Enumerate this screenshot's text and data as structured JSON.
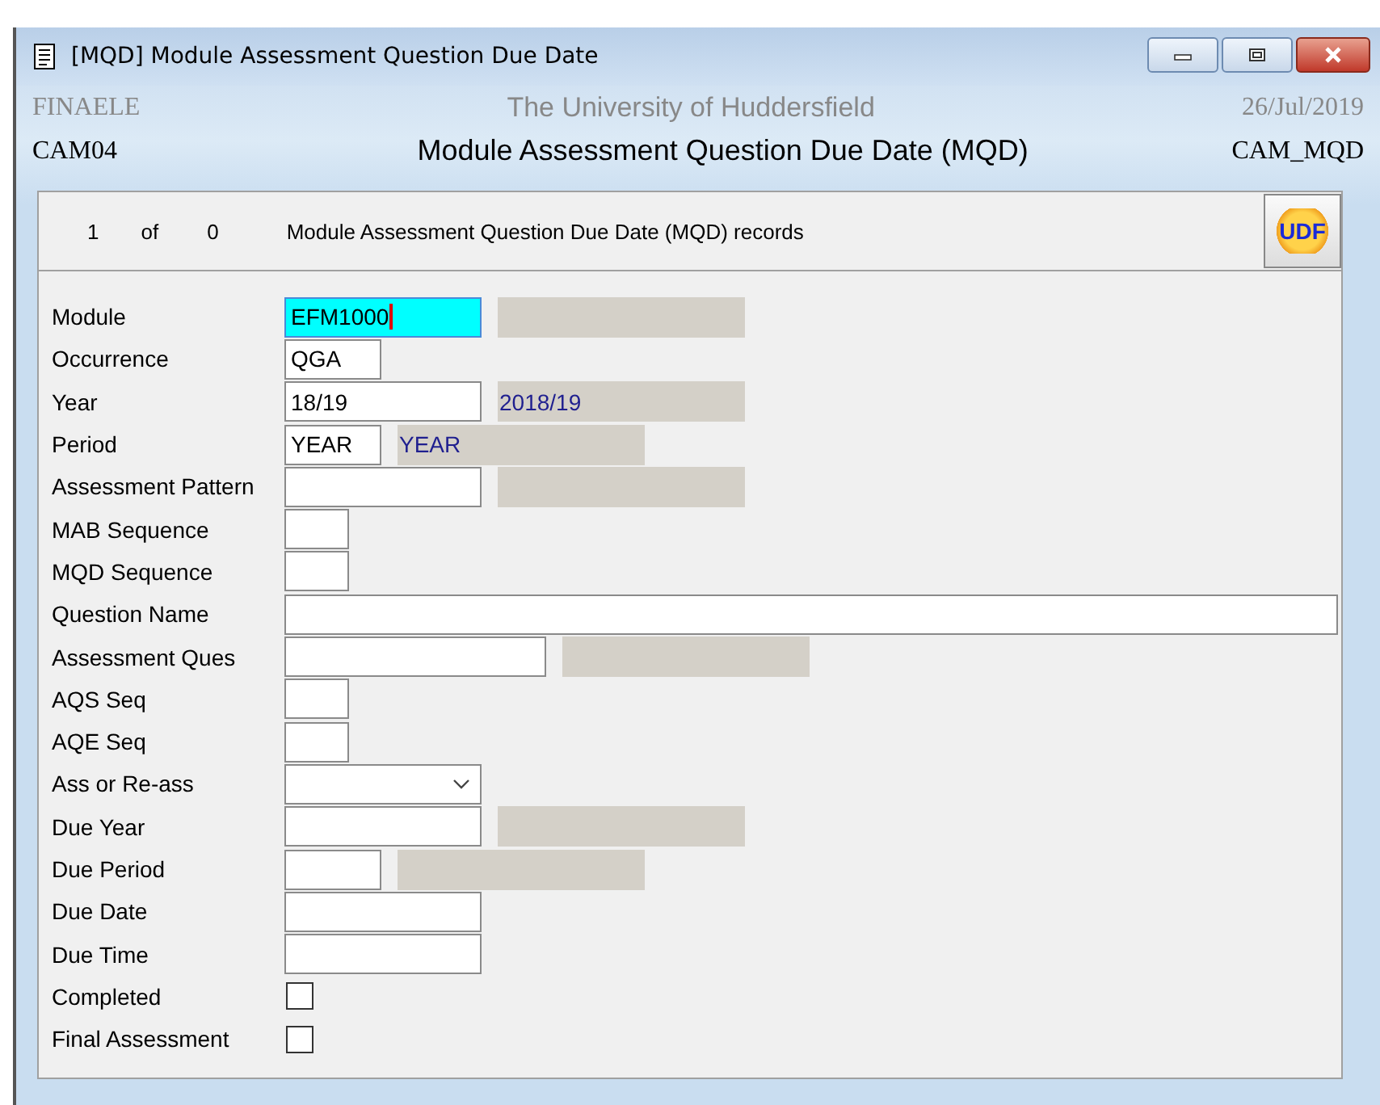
{
  "window": {
    "title": "[MQD] Module Assessment Question Due Date"
  },
  "header": {
    "system": "FINAELE",
    "institution": "The University of Huddersfield",
    "date": "26/Jul/2019",
    "screen_code": "CAM04",
    "screen_title": "Module Assessment Question Due Date (MQD)",
    "screen_id": "CAM_MQD"
  },
  "record_bar": {
    "current": "1",
    "of": "of",
    "total": "0",
    "description": "Module Assessment Question Due Date (MQD) records",
    "udf_button": "UDF"
  },
  "fields": [
    {
      "label": "Module",
      "kind": "text",
      "value": "EFM1000",
      "focused": true,
      "lookup_box": true
    },
    {
      "label": "Occurrence",
      "kind": "text",
      "value": "QGA",
      "focused": false,
      "lookup_box": false
    },
    {
      "label": "Year",
      "kind": "text",
      "value": "18/19",
      "focused": false,
      "lookup_box": true,
      "lookup": "2018/19"
    },
    {
      "label": "Period",
      "kind": "text",
      "value": "YEAR",
      "focused": false,
      "lookup_box": true,
      "lookup": "YEAR"
    },
    {
      "label": "Assessment Pattern",
      "kind": "text",
      "focused": false,
      "lookup_box": true
    },
    {
      "label": "MAB Sequence",
      "kind": "text",
      "focused": false,
      "lookup_box": false
    },
    {
      "label": "MQD Sequence",
      "kind": "text",
      "focused": false,
      "lookup_box": false
    },
    {
      "label": "Question Name",
      "kind": "text",
      "focused": false,
      "lookup_box": false
    },
    {
      "label": "Assessment Ques",
      "kind": "text",
      "focused": false,
      "lookup_box": true
    },
    {
      "label": "AQS Seq",
      "kind": "text",
      "focused": false,
      "lookup_box": false
    },
    {
      "label": "AQE Seq",
      "kind": "text",
      "focused": false,
      "lookup_box": false
    },
    {
      "label": "Ass or Re-ass",
      "kind": "select",
      "focused": false,
      "lookup_box": false
    },
    {
      "label": "Due Year",
      "kind": "text",
      "focused": false,
      "lookup_box": true
    },
    {
      "label": "Due Period",
      "kind": "text",
      "focused": false,
      "lookup_box": true
    },
    {
      "label": "Due Date",
      "kind": "text",
      "focused": false,
      "lookup_box": false
    },
    {
      "label": "Due Time",
      "kind": "text",
      "focused": false,
      "lookup_box": false
    },
    {
      "label": "Completed",
      "kind": "checkbox",
      "checked": false
    },
    {
      "label": "Final Assessment",
      "kind": "checkbox",
      "checked": false
    }
  ]
}
